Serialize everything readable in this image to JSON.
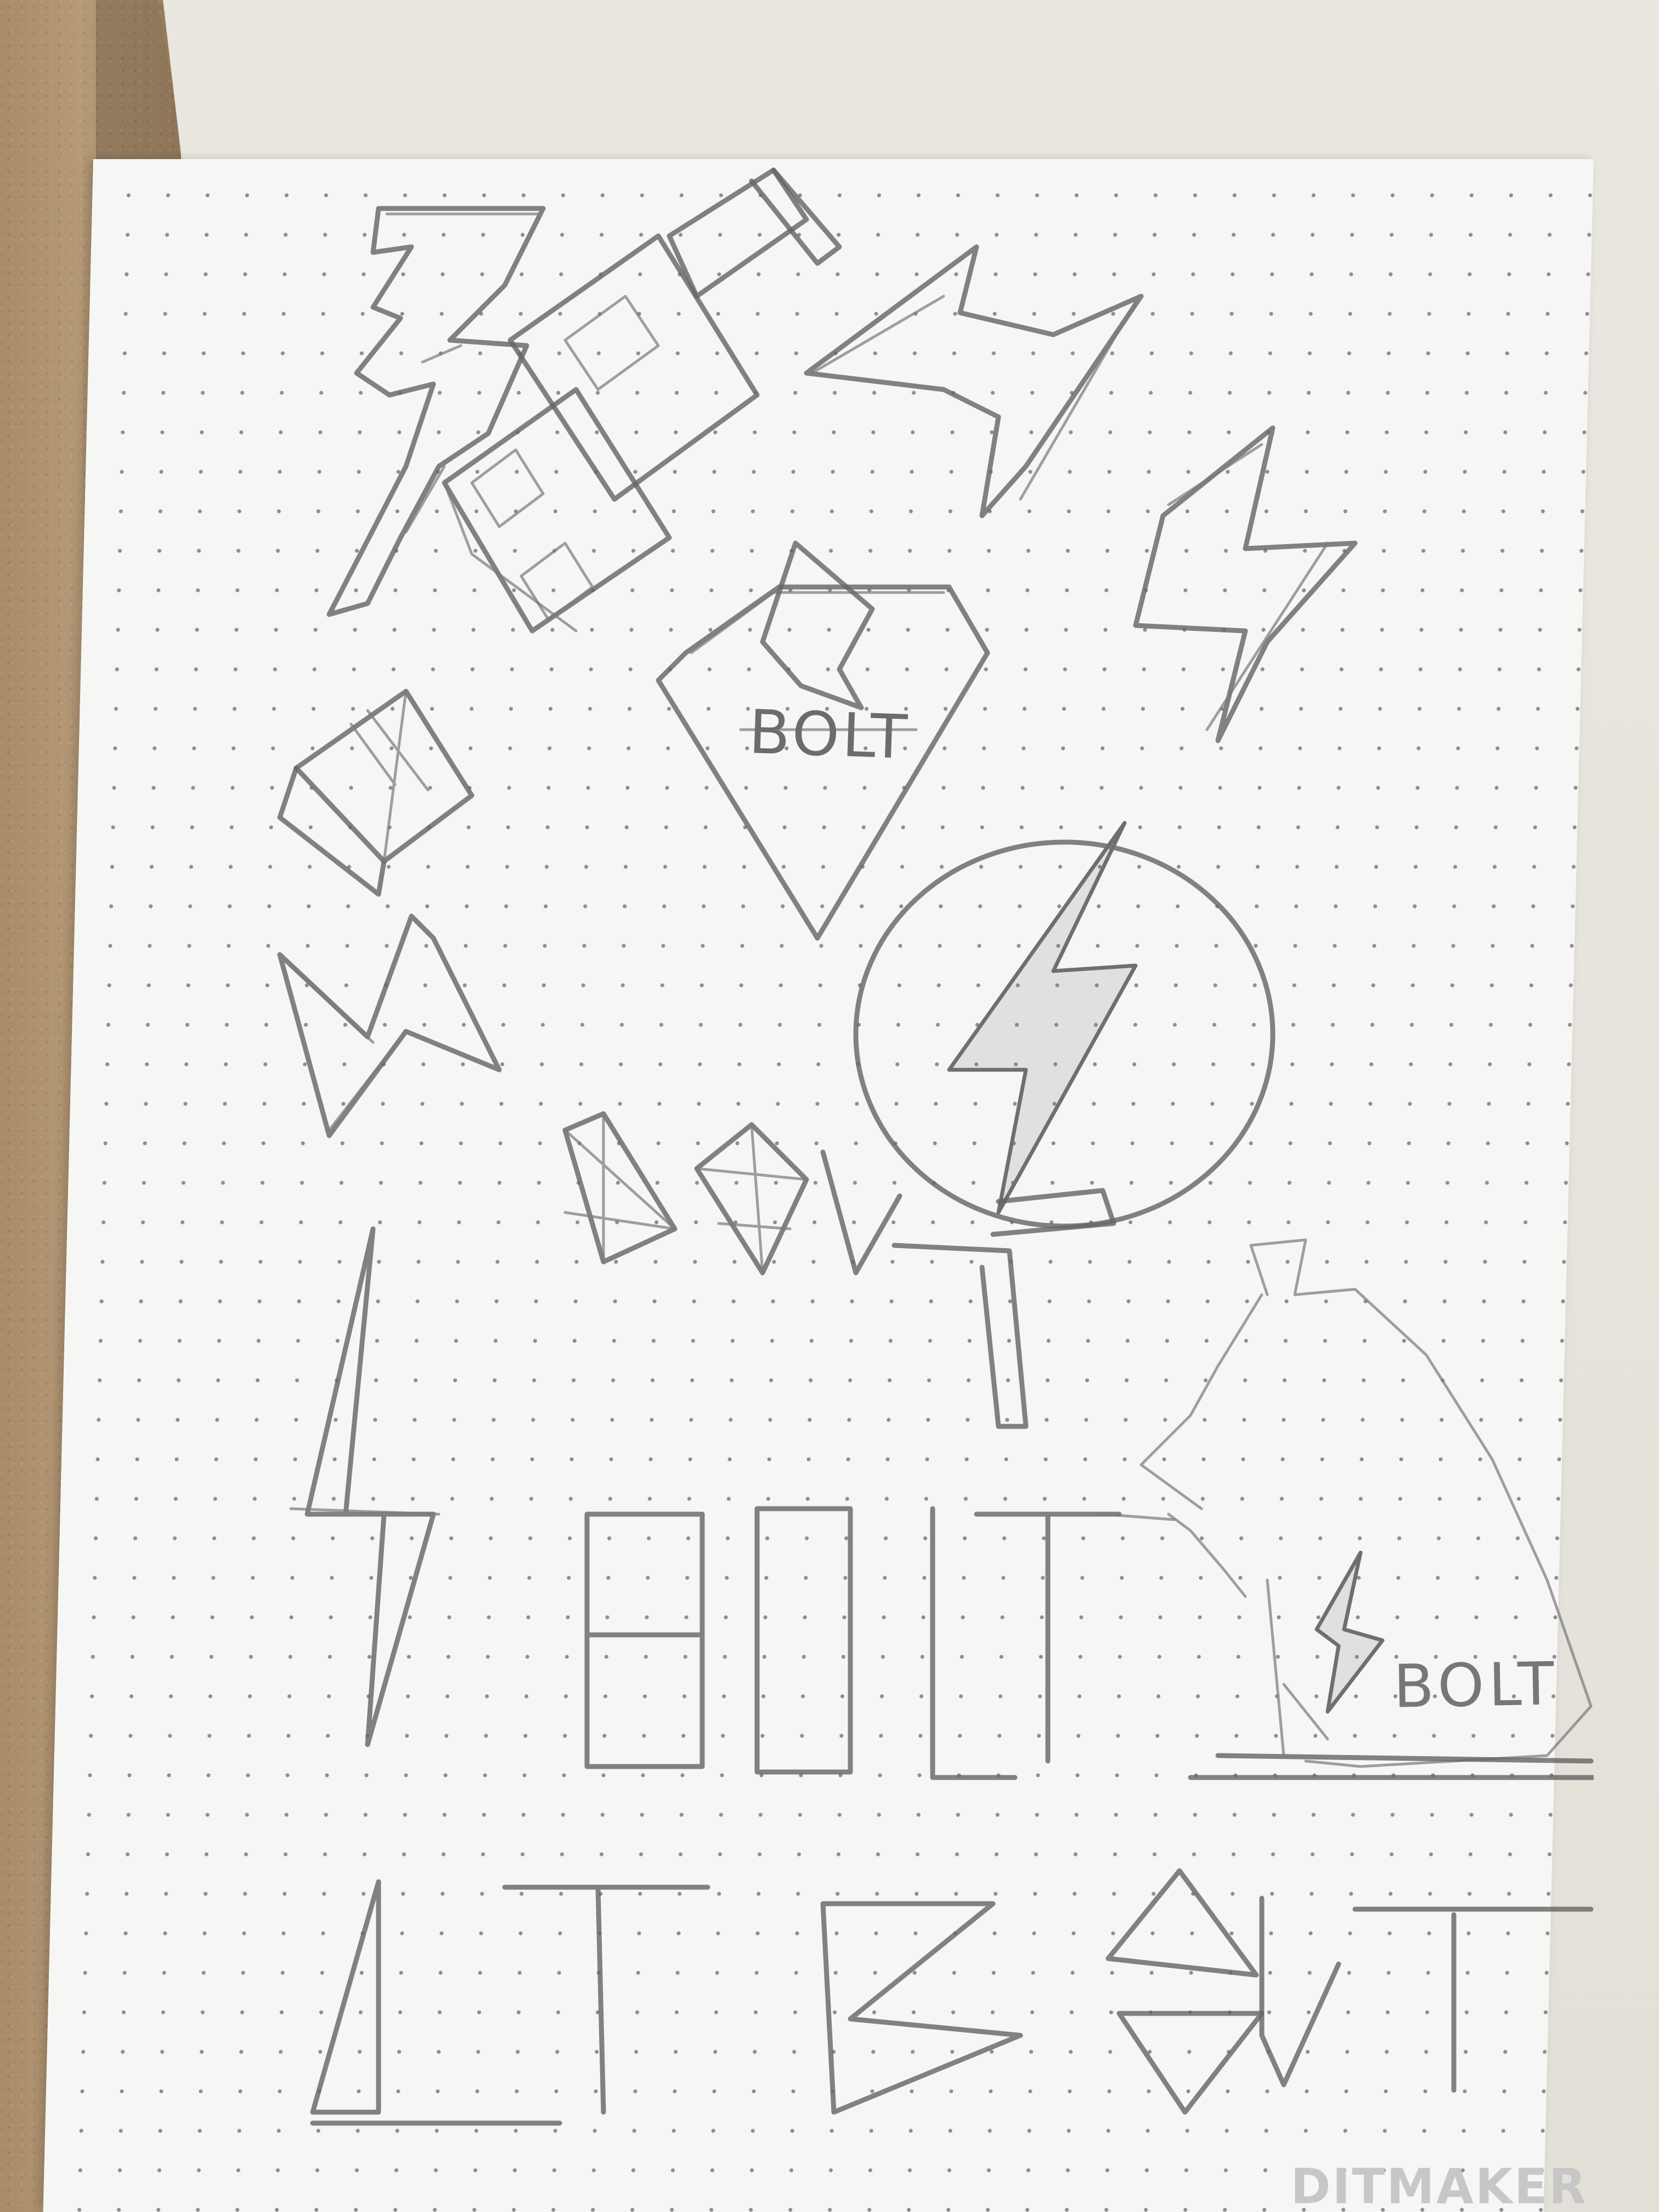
{
  "photo": {
    "sketches": {
      "bolt_text_one": "BOLT",
      "bolt_text_two": "BOLT"
    },
    "brand": "DITMAKER"
  }
}
